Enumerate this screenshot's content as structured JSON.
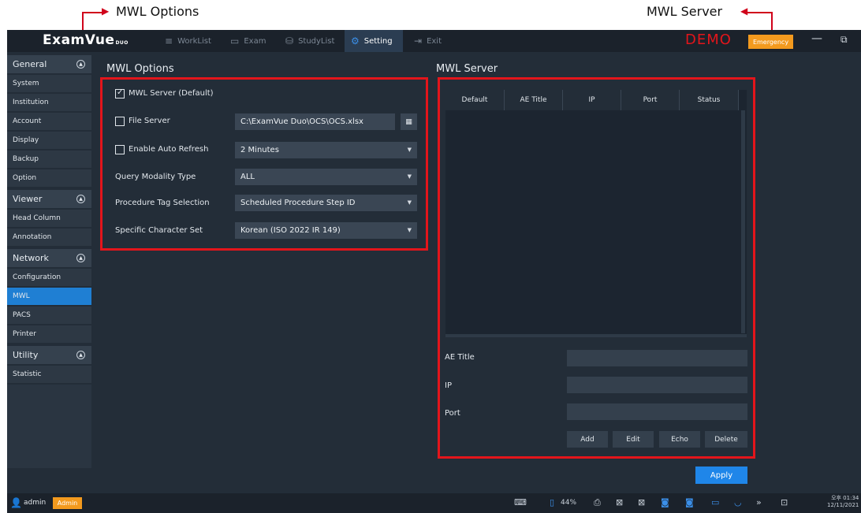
{
  "callouts": {
    "left": "MWL Options",
    "right": "MWL Server"
  },
  "app": {
    "logo": "ExamVue",
    "logo_sub": "DUO",
    "nav": [
      {
        "icon": "≡",
        "label": "WorkList"
      },
      {
        "icon": "▭",
        "label": "Exam"
      },
      {
        "icon": "⛁",
        "label": "StudyList"
      },
      {
        "icon": "⚙",
        "label": "Setting"
      },
      {
        "icon": "⇥",
        "label": "Exit"
      }
    ],
    "demo": "DEMO",
    "emergency": "Emergency"
  },
  "sidebar": {
    "general": {
      "title": "General",
      "items": [
        "System",
        "Institution",
        "Account",
        "Display",
        "Backup",
        "Option"
      ]
    },
    "viewer": {
      "title": "Viewer",
      "items": [
        "Head Column",
        "Annotation"
      ]
    },
    "network": {
      "title": "Network",
      "items": [
        "Configuration",
        "MWL",
        "PACS",
        "Printer"
      ],
      "active": "MWL"
    },
    "utility": {
      "title": "Utility",
      "items": [
        "Statistic"
      ]
    }
  },
  "mwl_options": {
    "title": "MWL Options",
    "mwl_server_default": {
      "label": "MWL Server (Default)",
      "checked": true
    },
    "file_server": {
      "label": "File Server",
      "checked": false,
      "value": "C:\\ExamVue Duo\\OCS\\OCS.xlsx"
    },
    "auto_refresh": {
      "label": "Enable Auto Refresh",
      "checked": false,
      "value": "2 Minutes"
    },
    "query_modality": {
      "label": "Query Modality Type",
      "value": "ALL"
    },
    "procedure_tag": {
      "label": "Procedure Tag Selection",
      "value": "Scheduled Procedure Step ID"
    },
    "charset": {
      "label": "Specific Character Set",
      "value": "Korean (ISO 2022 IR 149)"
    }
  },
  "mwl_server": {
    "title": "MWL Server",
    "columns": [
      "Default",
      "AE Title",
      "IP",
      "Port",
      "Status"
    ],
    "ae_title_label": "AE Title",
    "ip_label": "IP",
    "port_label": "Port",
    "buttons": {
      "add": "Add",
      "edit": "Edit",
      "echo": "Echo",
      "delete": "Delete"
    },
    "apply": "Apply"
  },
  "status": {
    "user": "admin",
    "role": "Admin",
    "battery": "44%",
    "time": "오후 01:34",
    "date": "12/11/2021"
  },
  "colors": {
    "accent": "#1f7fd3",
    "highlight": "#e3151b",
    "badge": "#f39a1e"
  }
}
